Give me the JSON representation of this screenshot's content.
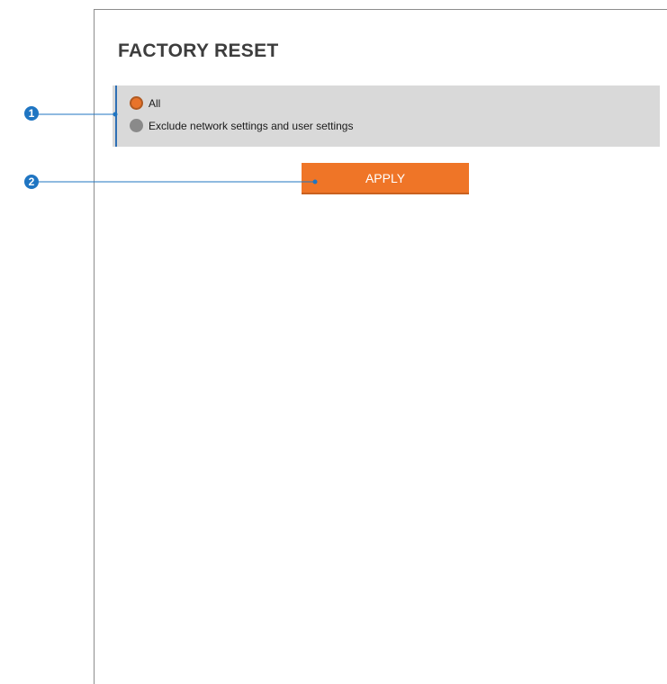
{
  "page": {
    "title": "FACTORY RESET"
  },
  "options": {
    "items": [
      {
        "label": "All",
        "selected": true
      },
      {
        "label": "Exclude network settings and user settings",
        "selected": false
      }
    ]
  },
  "actions": {
    "apply_label": "APPLY"
  },
  "callouts": {
    "one": "1",
    "two": "2"
  },
  "colors": {
    "accent_orange": "#ef7527",
    "callout_blue": "#1f75c2",
    "panel_gray": "#d9d9d9"
  }
}
